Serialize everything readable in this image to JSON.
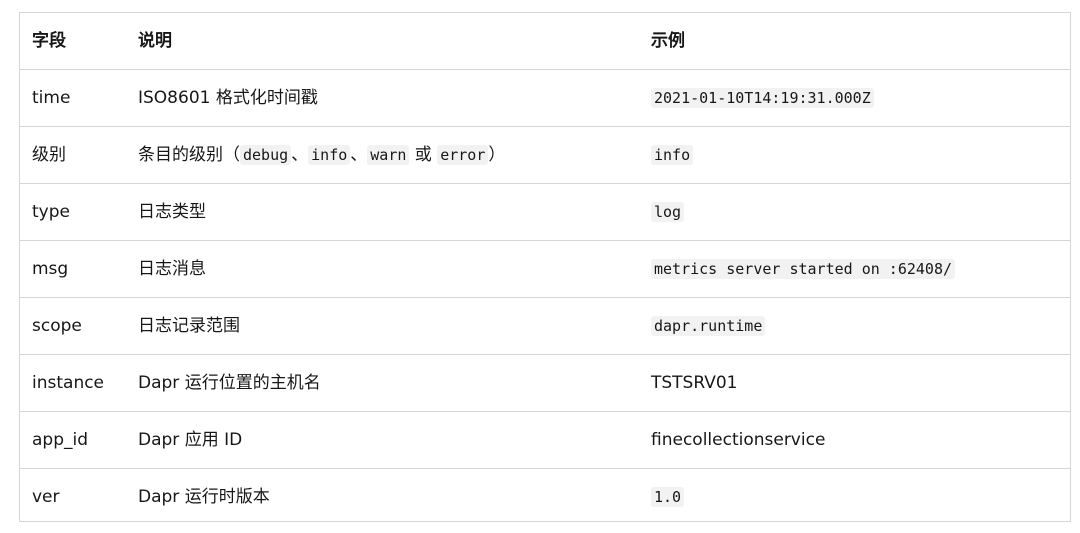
{
  "table": {
    "headers": [
      "字段",
      "说明",
      "示例"
    ],
    "rows": [
      {
        "field": "time",
        "desc": [
          {
            "t": "text",
            "v": "ISO8601 格式化时间戳"
          }
        ],
        "example": [
          {
            "t": "code",
            "v": "2021-01-10T14:19:31.000Z"
          }
        ]
      },
      {
        "field": "级别",
        "desc": [
          {
            "t": "text",
            "v": "条目的级别（"
          },
          {
            "t": "code",
            "v": "debug"
          },
          {
            "t": "text",
            "v": "、"
          },
          {
            "t": "code",
            "v": "info"
          },
          {
            "t": "text",
            "v": "、"
          },
          {
            "t": "code",
            "v": "warn"
          },
          {
            "t": "text",
            "v": " 或 "
          },
          {
            "t": "code",
            "v": "error"
          },
          {
            "t": "text",
            "v": "）"
          }
        ],
        "example": [
          {
            "t": "code",
            "v": "info"
          }
        ]
      },
      {
        "field": "type",
        "desc": [
          {
            "t": "text",
            "v": "日志类型"
          }
        ],
        "example": [
          {
            "t": "code",
            "v": "log"
          }
        ]
      },
      {
        "field": "msg",
        "desc": [
          {
            "t": "text",
            "v": "日志消息"
          }
        ],
        "example": [
          {
            "t": "code",
            "v": "metrics server started on :62408/"
          }
        ]
      },
      {
        "field": "scope",
        "desc": [
          {
            "t": "text",
            "v": "日志记录范围"
          }
        ],
        "example": [
          {
            "t": "code",
            "v": "dapr.runtime"
          }
        ]
      },
      {
        "field": "instance",
        "desc": [
          {
            "t": "text",
            "v": "Dapr 运行位置的主机名"
          }
        ],
        "example": [
          {
            "t": "text",
            "v": "TSTSRV01"
          }
        ]
      },
      {
        "field": "app_id",
        "desc": [
          {
            "t": "text",
            "v": "Dapr 应用 ID"
          }
        ],
        "example": [
          {
            "t": "text",
            "v": "finecollectionservice"
          }
        ]
      },
      {
        "field": "ver",
        "desc": [
          {
            "t": "text",
            "v": "Dapr 运行时版本"
          }
        ],
        "example": [
          {
            "t": "code",
            "v": "1.0"
          }
        ]
      }
    ]
  }
}
